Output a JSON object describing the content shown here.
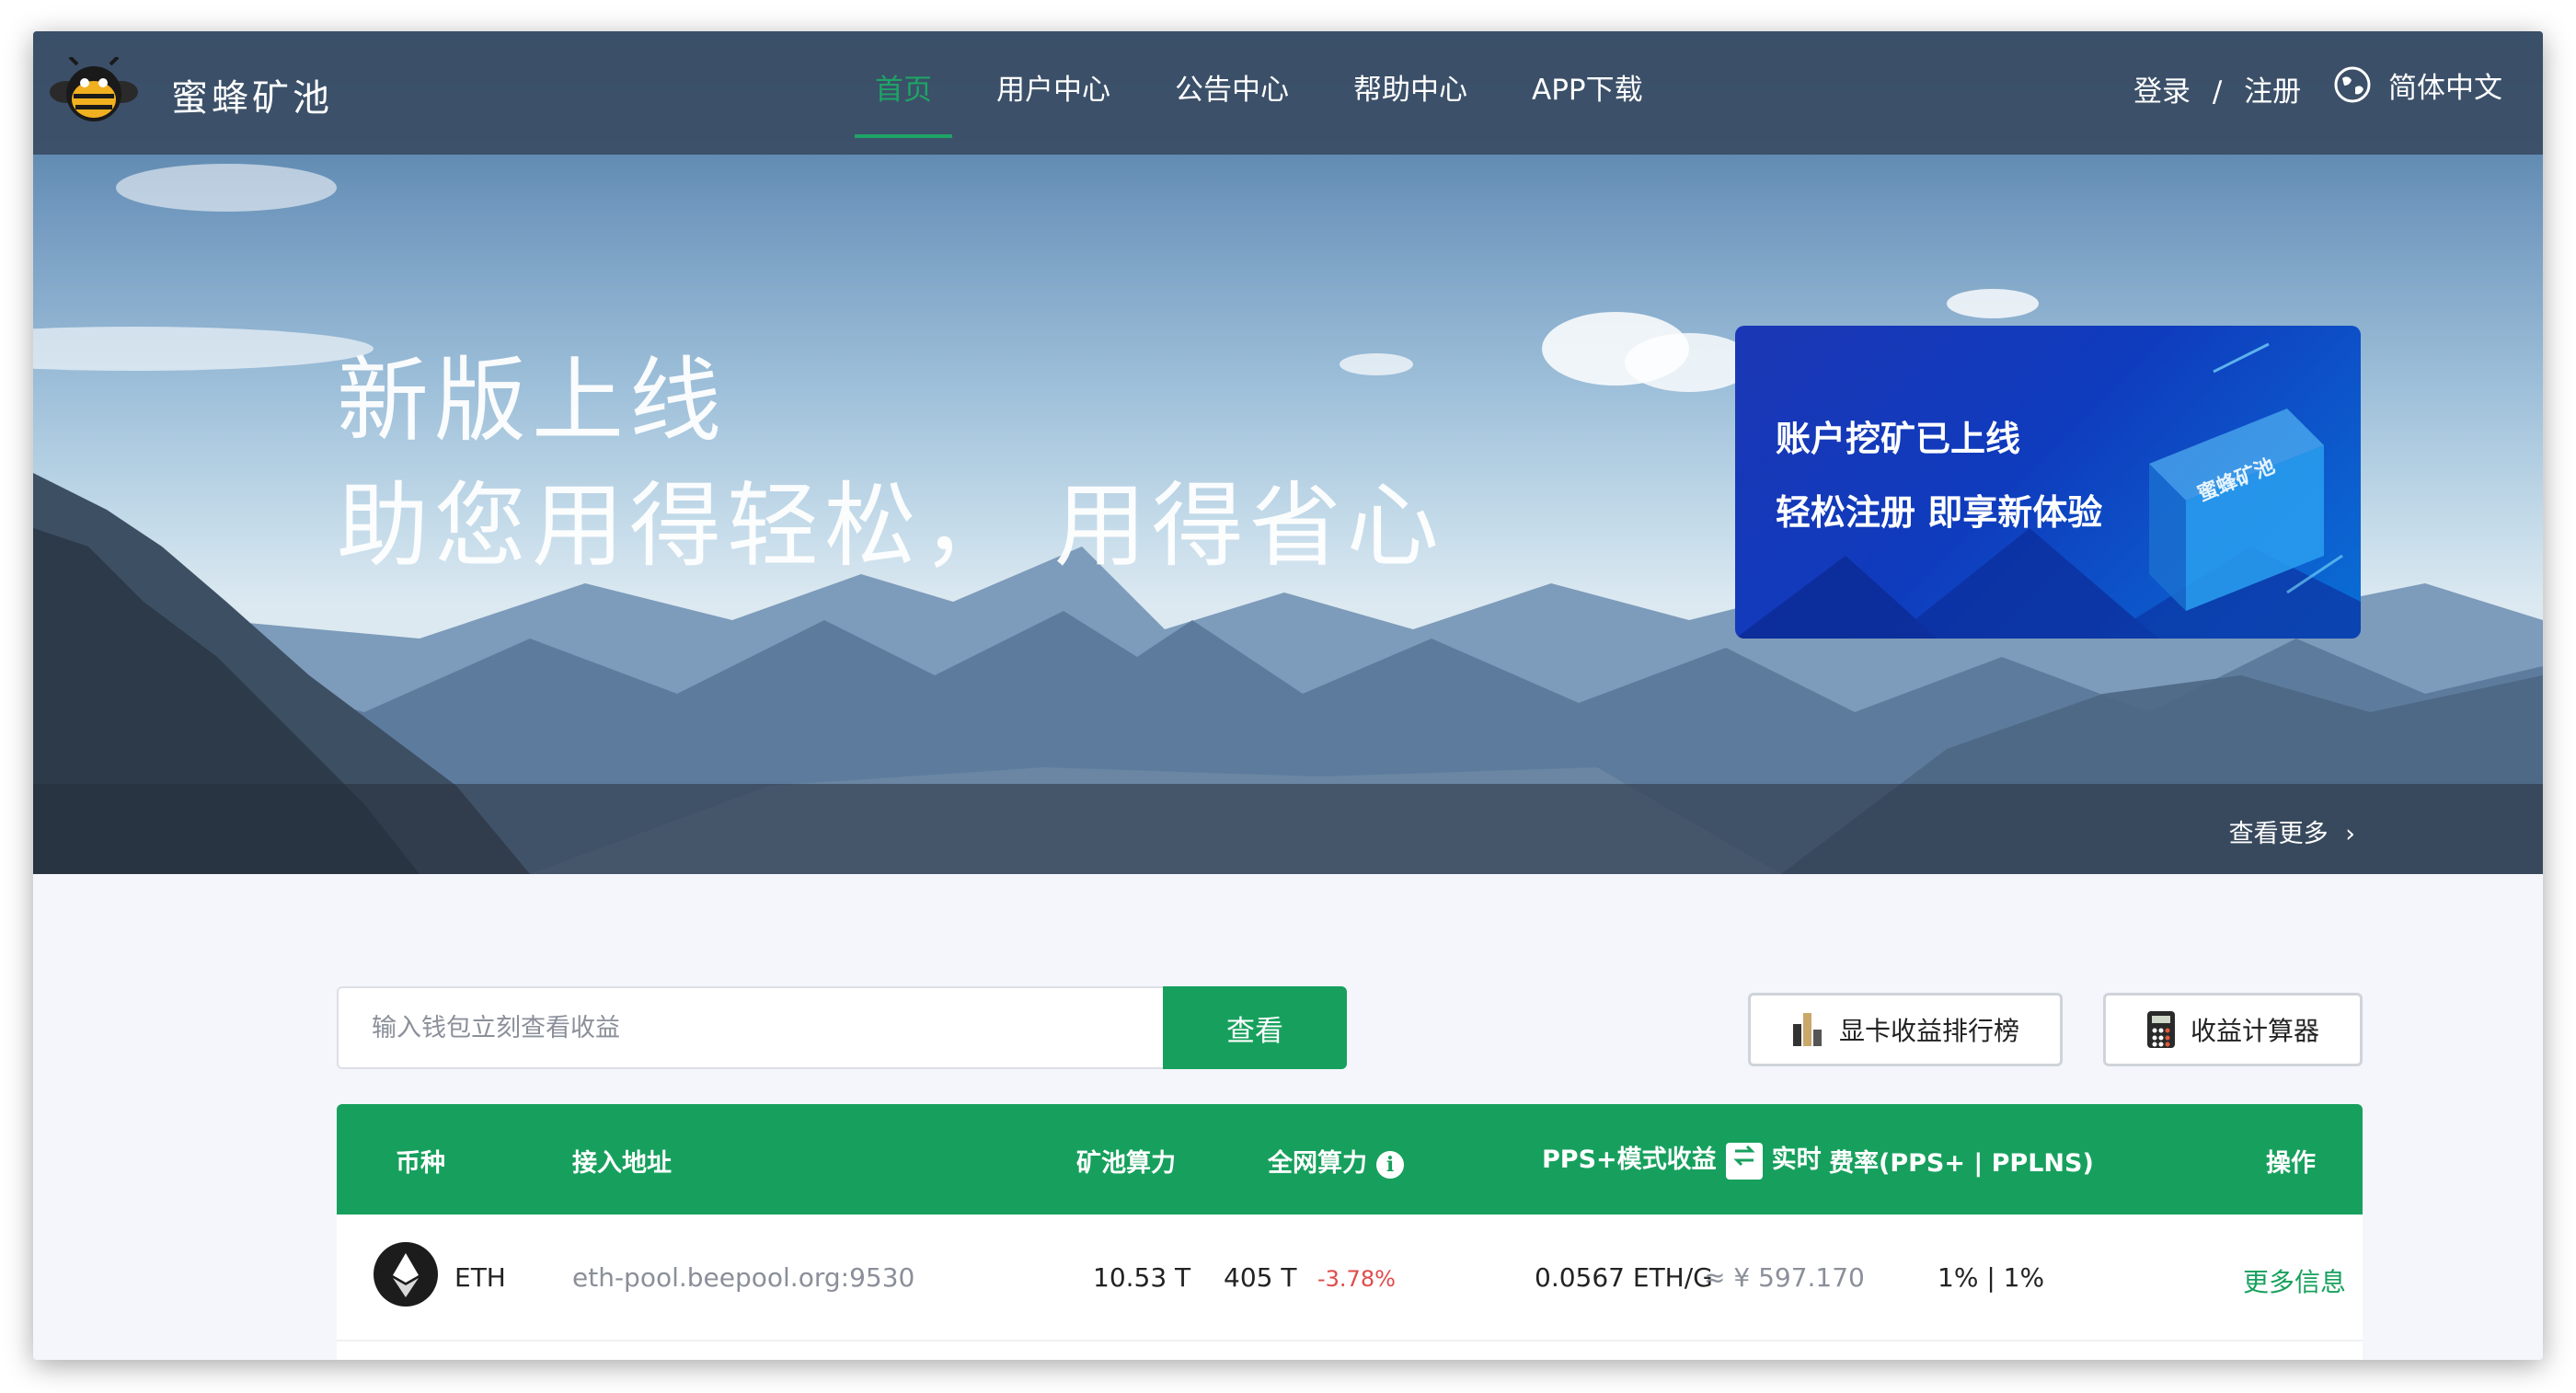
{
  "nav": {
    "brand": "蜜蜂矿池",
    "items": [
      {
        "label": "首页",
        "active": true
      },
      {
        "label": "用户中心"
      },
      {
        "label": "公告中心"
      },
      {
        "label": "帮助中心"
      },
      {
        "label": "APP下载"
      }
    ],
    "login": "登录",
    "separator": "/",
    "register": "注册",
    "language": "简体中文"
  },
  "hero": {
    "title": "新版上线",
    "subtitle": "助您用得轻松， 用得省心",
    "banner": {
      "line1": "账户挖矿已上线",
      "line2": "轻松注册 即享新体验",
      "badge": "蜜蜂矿池"
    },
    "more": "查看更多",
    "more_icon": "chevron-right-icon"
  },
  "search": {
    "placeholder": "输入钱包立刻查看收益",
    "button": "查看"
  },
  "tools": {
    "gpu_rank": "显卡收益排行榜",
    "calculator": "收益计算器"
  },
  "table": {
    "headers": {
      "coin": "币种",
      "address": "接入地址",
      "pool_hashrate": "矿池算力",
      "network_hashrate": "全网算力",
      "pps_income": "PPS+模式收益",
      "realtime": "实时",
      "fee": "费率(PPS+ | PPLNS)",
      "action": "操作"
    },
    "rows": [
      {
        "coin": "ETH",
        "address": "eth-pool.beepool.org:9530",
        "pool_hashrate": "10.53 T",
        "network_hashrate": "405 T",
        "change": "-3.78%",
        "income": "0.0567 ETH/G",
        "income_cny": "≈ ¥ 597.170",
        "fee": "1% | 1%",
        "action": "更多信息"
      }
    ]
  },
  "colors": {
    "accent": "#17a05d",
    "nav_bg": "#3a4c64",
    "negative": "#e14b4b"
  }
}
